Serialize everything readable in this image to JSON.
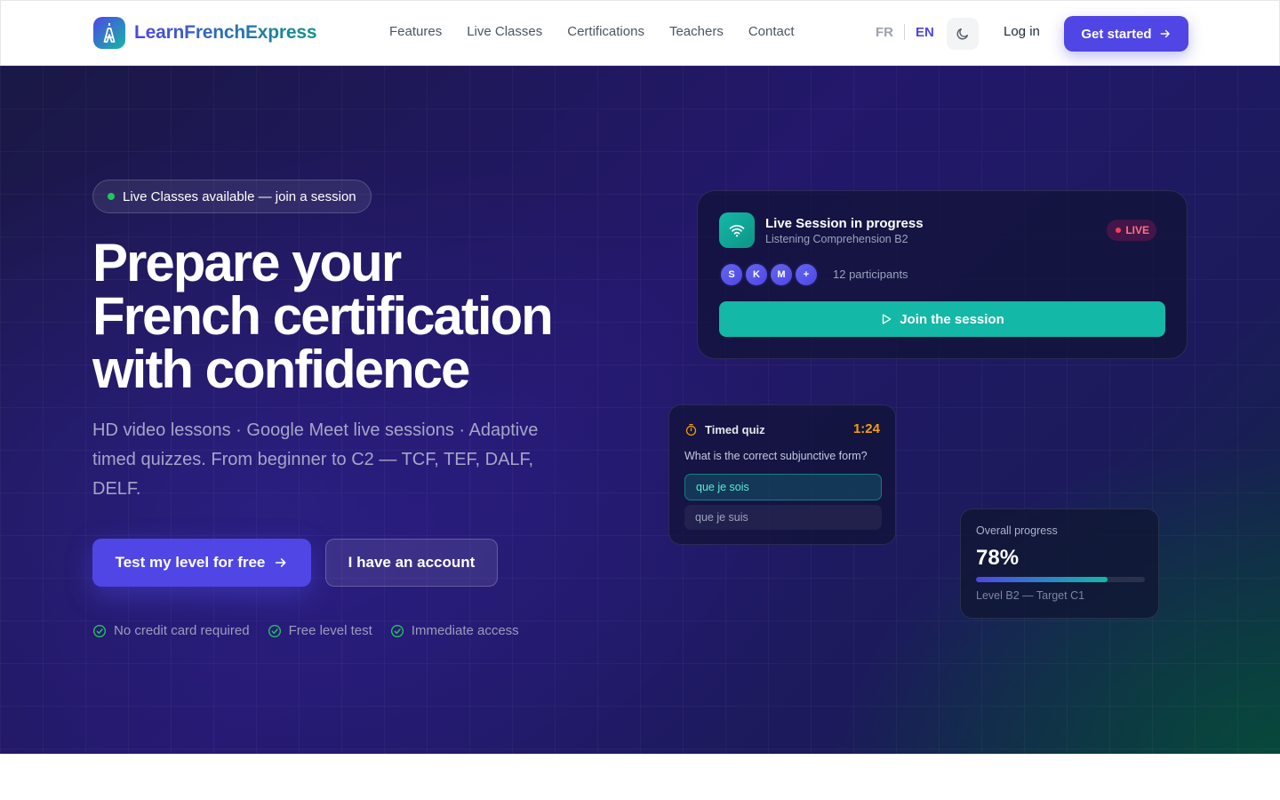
{
  "header": {
    "brand": "LearnFrenchExpress",
    "nav": [
      "Features",
      "Live Classes",
      "Certifications",
      "Teachers",
      "Contact"
    ],
    "lang_fr": "FR",
    "lang_en": "EN",
    "login": "Log in",
    "get_started": "Get started"
  },
  "hero": {
    "badge": "Live Classes available — join a session",
    "headline_line1": "Prepare your",
    "headline_line2": "French certification",
    "headline_line3": "with confidence",
    "subtitle": "HD video lessons · Google Meet live sessions · Adaptive timed quizzes. From beginner to C2 — TCF, TEF, DALF, DELF.",
    "cta_primary": "Test my level for free",
    "cta_secondary": "I have an account",
    "checks": [
      "No credit card required",
      "Free level test",
      "Immediate access"
    ]
  },
  "live_session": {
    "title": "Live Session in progress",
    "subtitle": "Listening Comprehension B2",
    "badge": "LIVE",
    "avatars": [
      "S",
      "K",
      "M",
      "+"
    ],
    "participants": "12 participants",
    "join": "Join the session"
  },
  "quiz": {
    "title": "Timed quiz",
    "timer": "1:24",
    "question": "What is the correct subjunctive form?",
    "option_1": "que je sois",
    "option_2": "que je suis"
  },
  "progress": {
    "label": "Overall progress",
    "value": "78%",
    "fraction": 0.78,
    "target": "Level B2 — Target C1"
  },
  "colors": {
    "accent": "#4f46e5",
    "teal": "#14b8a6",
    "live": "#f43f5e",
    "timer": "#f59e0b"
  }
}
